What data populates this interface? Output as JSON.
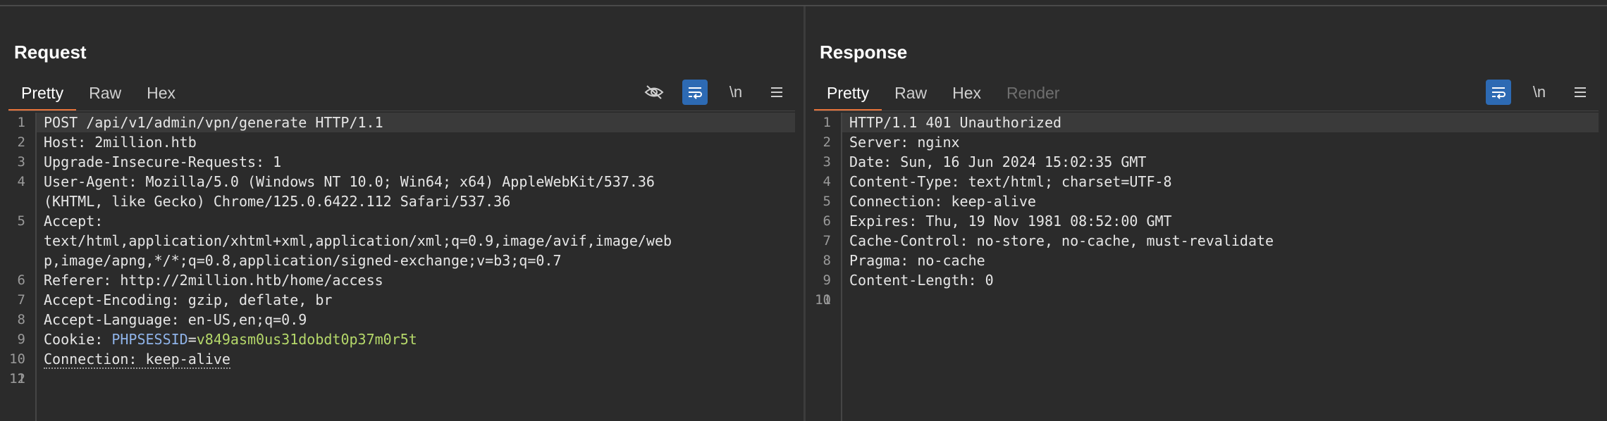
{
  "request": {
    "title": "Request",
    "tabs": [
      {
        "label": "Pretty",
        "active": true
      },
      {
        "label": "Raw",
        "active": false
      },
      {
        "label": "Hex",
        "active": false
      }
    ],
    "tools": {
      "newline_label": "\\n"
    },
    "lines": [
      {
        "n": "1",
        "text": "POST /api/v1/admin/vpn/generate HTTP/1.1"
      },
      {
        "n": "2",
        "key": "Host",
        "value": "2million.htb"
      },
      {
        "n": "3",
        "key": "Upgrade-Insecure-Requests",
        "value": "1"
      },
      {
        "n": "4",
        "key": "User-Agent",
        "value": "Mozilla/5.0 (Windows NT 10.0; Win64; x64) AppleWebKit/537.36"
      },
      {
        "n": "",
        "text": "(KHTML, like Gecko) Chrome/125.0.6422.112 Safari/537.36"
      },
      {
        "n": "5",
        "key": "Accept",
        "value": ""
      },
      {
        "n": "",
        "text": "text/html,application/xhtml+xml,application/xml;q=0.9,image/avif,image/web"
      },
      {
        "n": "",
        "text": "p,image/apng,*/*;q=0.8,application/signed-exchange;v=b3;q=0.7"
      },
      {
        "n": "6",
        "key": "Referer",
        "value": "http://2million.htb/home/access"
      },
      {
        "n": "7",
        "key": "Accept-Encoding",
        "value": "gzip, deflate, br"
      },
      {
        "n": "8",
        "key": "Accept-Language",
        "value": "en-US,en;q=0.9"
      },
      {
        "n": "9",
        "key": "Cookie",
        "cookie_name": "PHPSESSID",
        "cookie_value": "v849asm0us31dobdt0p37m0r5t"
      },
      {
        "n": "10",
        "key": "Connection",
        "value": "keep-alive"
      },
      {
        "n": "11",
        "text": ""
      },
      {
        "n": "12",
        "text": ""
      }
    ]
  },
  "response": {
    "title": "Response",
    "tabs": [
      {
        "label": "Pretty",
        "active": true
      },
      {
        "label": "Raw",
        "active": false
      },
      {
        "label": "Hex",
        "active": false
      },
      {
        "label": "Render",
        "active": false
      }
    ],
    "tools": {
      "newline_label": "\\n"
    },
    "lines": [
      {
        "n": "1",
        "text": "HTTP/1.1 401 Unauthorized"
      },
      {
        "n": "2",
        "key": "Server",
        "value": "nginx"
      },
      {
        "n": "3",
        "key": "Date",
        "value": "Sun, 16 Jun 2024 15:02:35 GMT"
      },
      {
        "n": "4",
        "key": "Content-Type",
        "value": "text/html; charset=UTF-8"
      },
      {
        "n": "5",
        "key": "Connection",
        "value": "keep-alive"
      },
      {
        "n": "6",
        "key": "Expires",
        "value": "Thu, 19 Nov 1981 08:52:00 GMT"
      },
      {
        "n": "7",
        "key": "Cache-Control",
        "value": "no-store, no-cache, must-revalidate"
      },
      {
        "n": "8",
        "key": "Pragma",
        "value": "no-cache"
      },
      {
        "n": "9",
        "key": "Content-Length",
        "value": "0"
      },
      {
        "n": "10",
        "text": ""
      },
      {
        "n": "11",
        "text": ""
      }
    ]
  },
  "colors": {
    "accent": "#2d6ab3",
    "tab_underline": "#e8743b",
    "cookie_value": "#b5d86a"
  }
}
